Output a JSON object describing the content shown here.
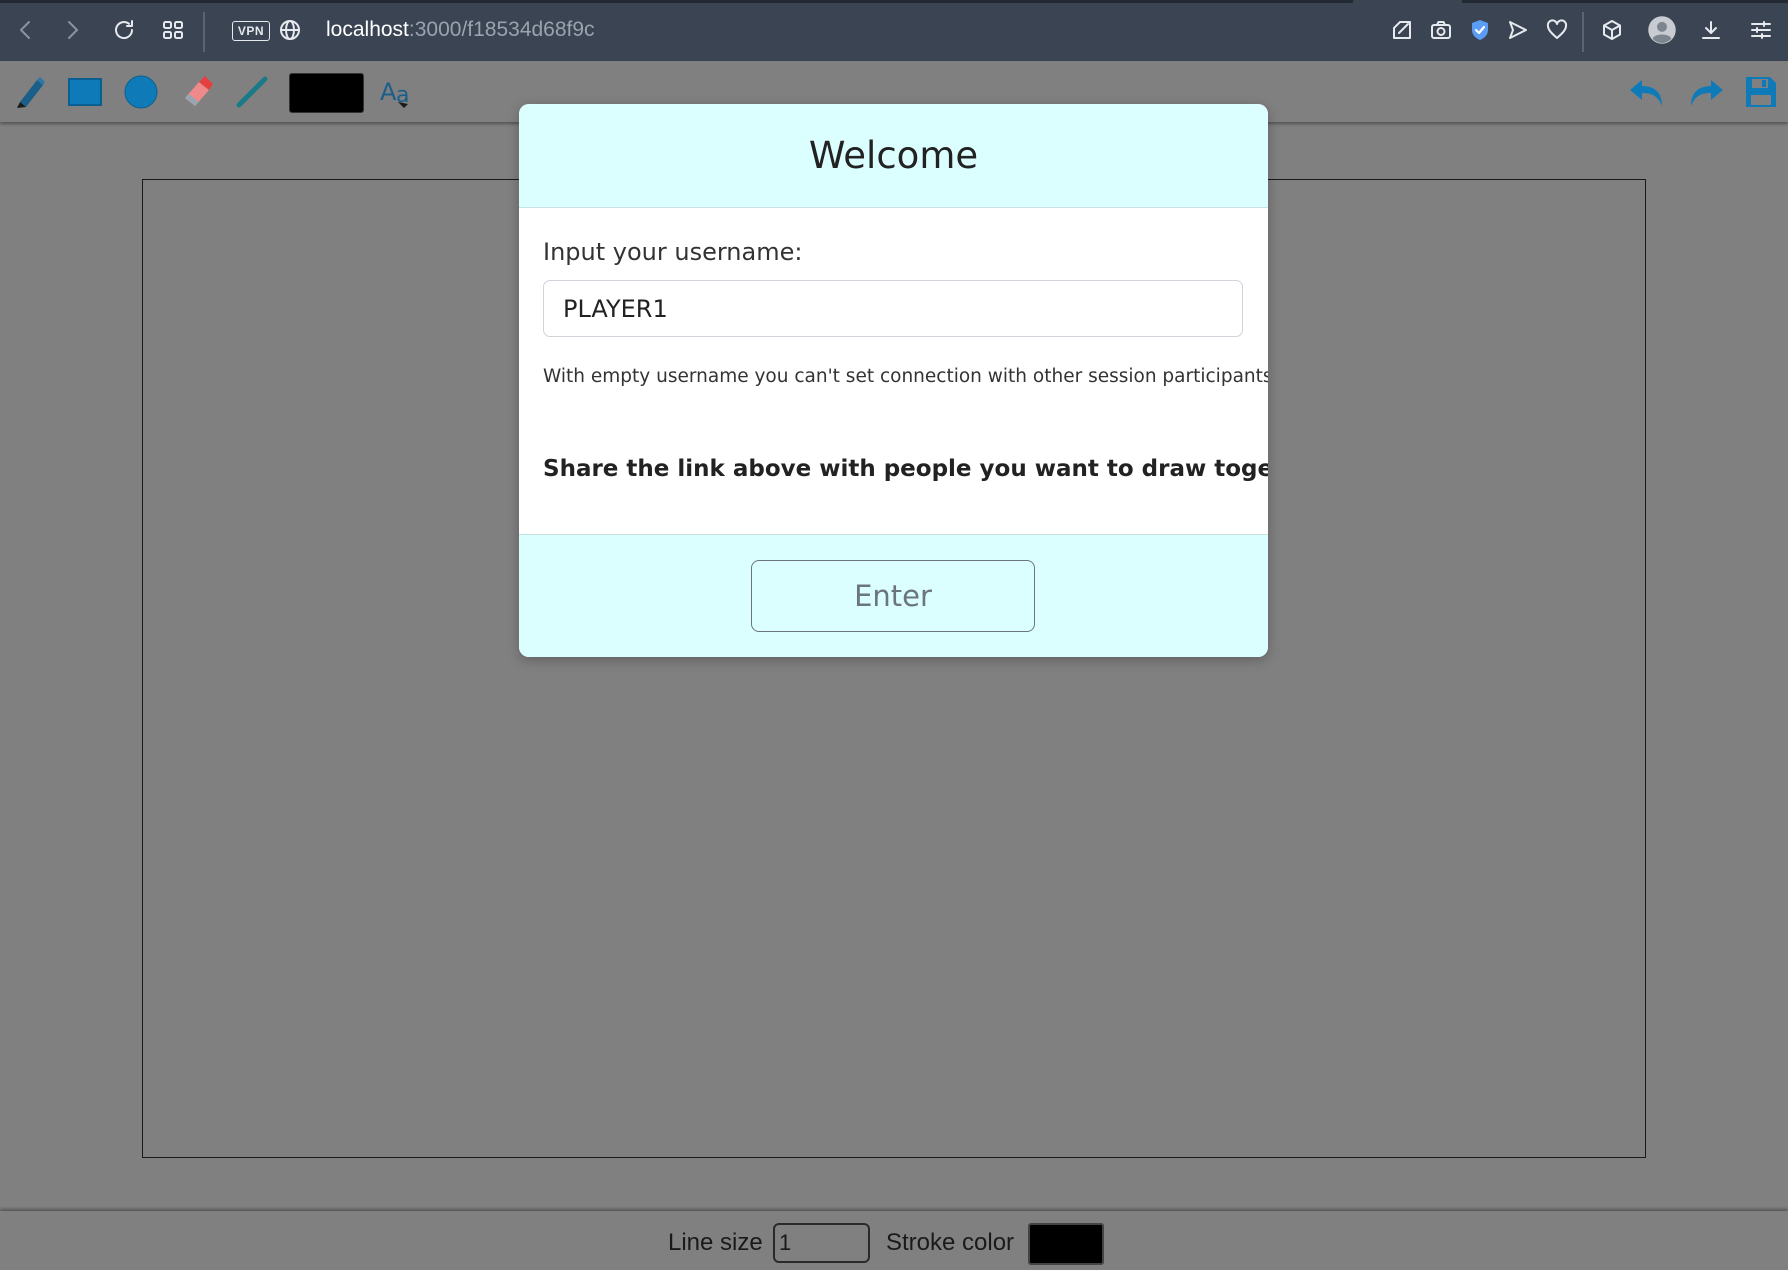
{
  "browser": {
    "vpn_label": "VPN",
    "url_host": "localhost",
    "url_path": ":3000/f18534d68f9c"
  },
  "toolbar": {
    "tools": [
      "pencil-icon",
      "rectangle-icon",
      "circle-icon",
      "eraser-icon",
      "line-icon",
      "color-swatch",
      "text-icon"
    ],
    "right_tools": [
      "undo-icon",
      "redo-icon",
      "save-icon"
    ],
    "active_color": "#000000",
    "accent": "#0f7ab8"
  },
  "modal": {
    "title": "Welcome",
    "field_label": "Input your username:",
    "username_value": "PLAYER1",
    "hint": "With empty username you can't set connection with other session participants.",
    "share_text": "Share the link above with people you want to draw together.",
    "enter_label": "Enter",
    "header_bg": "#dbffff"
  },
  "bottom": {
    "line_size_label": "Line size",
    "line_size_value": "1",
    "stroke_color_label": "Stroke color",
    "stroke_color": "#000000"
  }
}
